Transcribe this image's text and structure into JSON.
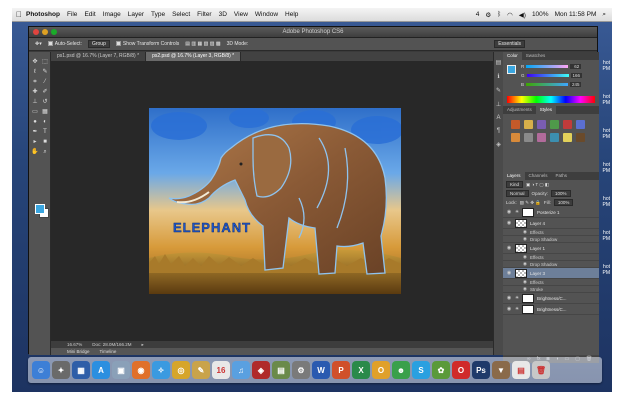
{
  "menubar": {
    "apple": "",
    "app": "Photoshop",
    "items": [
      "File",
      "Edit",
      "Image",
      "Layer",
      "Type",
      "Select",
      "Filter",
      "3D",
      "View",
      "Window",
      "Help"
    ],
    "status_icons": [
      "4",
      "100%",
      "Mon 11:58 PM"
    ],
    "clock": "Mon 11:58 PM"
  },
  "window": {
    "title": "Adobe Photoshop CS6"
  },
  "options_bar": {
    "auto_select_label": "Auto-Select:",
    "auto_select_value": "Group",
    "show_transform_label": "Show Transform Controls",
    "mode_label": "3D Mode:",
    "workspace": "Essentials"
  },
  "document_tabs": [
    {
      "label": "ps1.psd @ 16.7% (Layer 7, RGB/8) *",
      "active": false
    },
    {
      "label": "ps2.psd @ 16.7% (Layer 3, RGB/8) *",
      "active": true
    }
  ],
  "artwork": {
    "text": "ELEPHANT"
  },
  "status_bar": {
    "zoom": "16.67%",
    "doc": "Doc: 28.0M/166.2M"
  },
  "bottom_tabs": [
    "Mini Bridge",
    "Timeline"
  ],
  "color_panel": {
    "tabs": [
      "Color",
      "Swatches"
    ],
    "fg_color": "#3aa6e0",
    "channels": [
      {
        "label": "R",
        "value": "62"
      },
      {
        "label": "G",
        "value": "166"
      },
      {
        "label": "B",
        "value": "245"
      }
    ]
  },
  "adjustments_panel": {
    "tabs": [
      "Adjustments",
      "Styles"
    ],
    "swatches": [
      "#c45a2a",
      "#d6b04a",
      "#7a5db2",
      "#4f9a4a",
      "#c23b3b",
      "#5b6fd1",
      "#d88a3a",
      "#8a8a8a",
      "#b26b9b",
      "#3c8fb0",
      "#e2d15a",
      "#6a4a2a"
    ]
  },
  "layers_panel": {
    "tabs": [
      "Layers",
      "Channels",
      "Paths"
    ],
    "kind_label": "Kind",
    "blend_mode": "Normal",
    "opacity_label": "Opacity:",
    "opacity_value": "100%",
    "lock_label": "Lock:",
    "fill_label": "Fill:",
    "fill_value": "100%",
    "layers": [
      {
        "name": "Posterize 1",
        "type": "adjustment",
        "thumb": "white",
        "active": false
      },
      {
        "name": "Layer 4",
        "type": "layer",
        "thumb": "checker",
        "active": false
      },
      {
        "name": "Effects",
        "type": "sub",
        "active": false
      },
      {
        "name": "Drop Shadow",
        "type": "sub",
        "active": false
      },
      {
        "name": "Layer 1",
        "type": "layer",
        "thumb": "checker",
        "active": false
      },
      {
        "name": "Effects",
        "type": "sub",
        "active": false
      },
      {
        "name": "Drop Shadow",
        "type": "sub",
        "active": false
      },
      {
        "name": "Layer 3",
        "type": "layer",
        "thumb": "checker",
        "active": true
      },
      {
        "name": "Effects",
        "type": "sub",
        "active": false
      },
      {
        "name": "Stroke",
        "type": "sub",
        "active": false
      },
      {
        "name": "Brightness/C...",
        "type": "adjustment",
        "thumb": "white",
        "active": false
      },
      {
        "name": "Brightness/C...",
        "type": "adjustment",
        "thumb": "white",
        "active": false
      }
    ]
  },
  "desktop_labels": [
    "hot",
    "PM",
    "hot",
    "PM",
    "hot",
    "PM",
    "hot",
    "PM",
    "hot",
    "PM",
    "hot",
    "PM",
    "hot",
    "PM"
  ],
  "dock": {
    "icons": [
      {
        "name": "finder-icon",
        "glyph": "☺",
        "color": "#3d7fd6"
      },
      {
        "name": "launchpad-icon",
        "glyph": "✦",
        "color": "#6a6a6a"
      },
      {
        "name": "mission-control-icon",
        "glyph": "▦",
        "color": "#2e5ea8"
      },
      {
        "name": "app-store-icon",
        "glyph": "A",
        "color": "#2b8fe0"
      },
      {
        "name": "preview-icon",
        "glyph": "▣",
        "color": "#8aa0b8"
      },
      {
        "name": "firefox-icon",
        "glyph": "◉",
        "color": "#e0702a"
      },
      {
        "name": "safari-icon",
        "glyph": "✧",
        "color": "#3a9ae0"
      },
      {
        "name": "chrome-icon",
        "glyph": "◎",
        "color": "#d6a52a"
      },
      {
        "name": "notes-icon",
        "glyph": "✎",
        "color": "#c9a34a"
      },
      {
        "name": "calendar-icon",
        "glyph": "16",
        "color": "#e8e8e8"
      },
      {
        "name": "itunes-icon",
        "glyph": "♫",
        "color": "#5aa0e0"
      },
      {
        "name": "photo-booth-icon",
        "glyph": "◈",
        "color": "#b02a2a"
      },
      {
        "name": "iphoto-icon",
        "glyph": "▤",
        "color": "#6a8a4a"
      },
      {
        "name": "system-preferences-icon",
        "glyph": "⚙",
        "color": "#7a7a7a"
      },
      {
        "name": "word-icon",
        "glyph": "W",
        "color": "#2a5ab0"
      },
      {
        "name": "powerpoint-icon",
        "glyph": "P",
        "color": "#d0502a"
      },
      {
        "name": "excel-icon",
        "glyph": "X",
        "color": "#2a8a4a"
      },
      {
        "name": "outlook-icon",
        "glyph": "O",
        "color": "#e0a02a"
      },
      {
        "name": "messenger-icon",
        "glyph": "☻",
        "color": "#3aa04a"
      },
      {
        "name": "skype-icon",
        "glyph": "S",
        "color": "#2aa0e0"
      },
      {
        "name": "photos-icon",
        "glyph": "✿",
        "color": "#5a9a3a"
      },
      {
        "name": "opera-icon",
        "glyph": "O",
        "color": "#d02a2a"
      },
      {
        "name": "photoshop-icon",
        "glyph": "Ps",
        "color": "#1f3a6a"
      },
      {
        "name": "downloads-icon",
        "glyph": "▼",
        "color": "#8a6a4a"
      },
      {
        "name": "documents-icon",
        "glyph": "▤",
        "color": "#e8e8e8"
      },
      {
        "name": "trash-icon",
        "glyph": "🗑",
        "color": "#c8c8c8"
      }
    ]
  }
}
